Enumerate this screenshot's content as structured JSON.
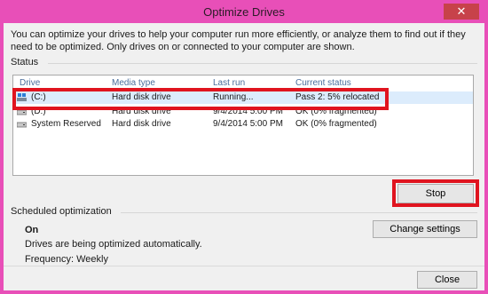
{
  "window": {
    "title": "Optimize Drives",
    "close_glyph": "✕"
  },
  "description": "You can optimize your drives to help your computer run more efficiently, or analyze them to find out if they need to be optimized. Only drives on or connected to your computer are shown.",
  "status_section": {
    "label": "Status",
    "columns": [
      "Drive",
      "Media type",
      "Last run",
      "Current status"
    ],
    "rows": [
      {
        "drive": "(C:)",
        "media": "Hard disk drive",
        "last_run": "Running...",
        "status": "Pass 2: 5% relocated"
      },
      {
        "drive": "(D:)",
        "media": "Hard disk drive",
        "last_run": "9/4/2014 5:00 PM",
        "status": "OK (0% fragmented)"
      },
      {
        "drive": "System Reserved",
        "media": "Hard disk drive",
        "last_run": "9/4/2014 5:00 PM",
        "status": "OK (0% fragmented)"
      }
    ]
  },
  "buttons": {
    "stop": "Stop",
    "change_settings": "Change settings",
    "close": "Close"
  },
  "scheduled": {
    "label": "Scheduled optimization",
    "state": "On",
    "detail": "Drives are being optimized automatically.",
    "frequency": "Frequency: Weekly"
  },
  "colors": {
    "title_bar": "#e84fb8",
    "highlight": "#e0141f",
    "selection": "#dcecfc",
    "header_text": "#4a6e9c"
  }
}
